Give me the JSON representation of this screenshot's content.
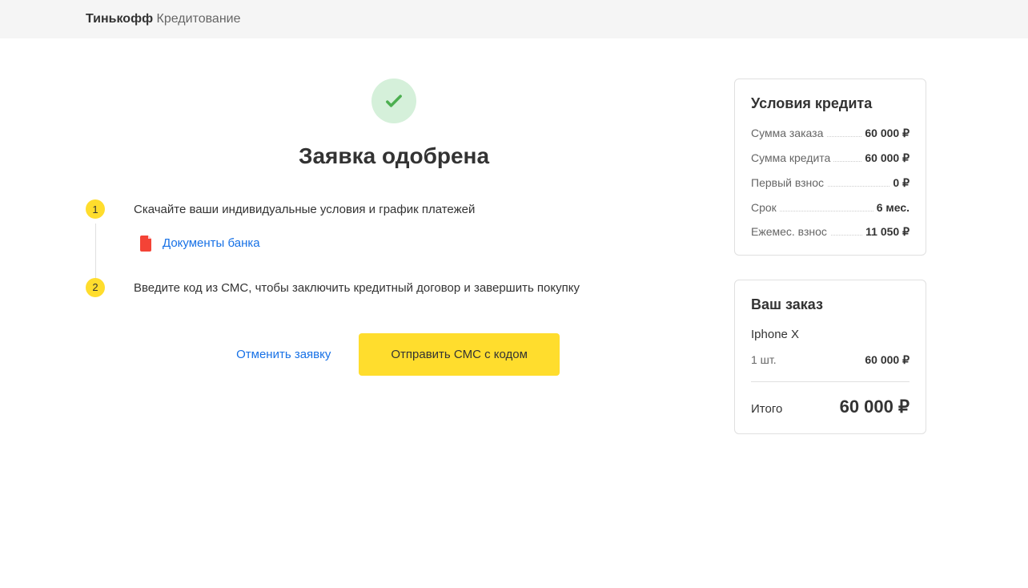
{
  "header": {
    "brand": "Тинькофф",
    "product": " Кредитование"
  },
  "main": {
    "title": "Заявка одобрена",
    "step1": {
      "number": "1",
      "text_pre": "Скачайте ваши ",
      "text_bold": "индивидуальные условия",
      "text_mid": " и ",
      "text_bold2": "график платежей",
      "doc_link": "Документы банка"
    },
    "step2": {
      "number": "2",
      "text": "Введите код из СМС, чтобы заключить кредитный договор и завершить покупку"
    },
    "actions": {
      "cancel": "Отменить заявку",
      "send_sms": "Отправить СМС с кодом"
    }
  },
  "credit": {
    "title": "Условия кредита",
    "order_sum_label": "Сумма заказа",
    "order_sum_value": "60 000 ₽",
    "credit_sum_label": "Сумма кредита",
    "credit_sum_value": "60 000 ₽",
    "initial_label": "Первый взнос",
    "initial_value": "0 ₽",
    "term_label": "Срок",
    "term_value": "6 мес.",
    "monthly_label": "Ежемес. взнос",
    "monthly_value": "11 050 ₽"
  },
  "order": {
    "title": "Ваш заказ",
    "item_name": "Iphone X",
    "qty": "1 шт.",
    "price": "60 000 ₽",
    "total_label": "Итого",
    "total_value": "60 000 ₽"
  }
}
